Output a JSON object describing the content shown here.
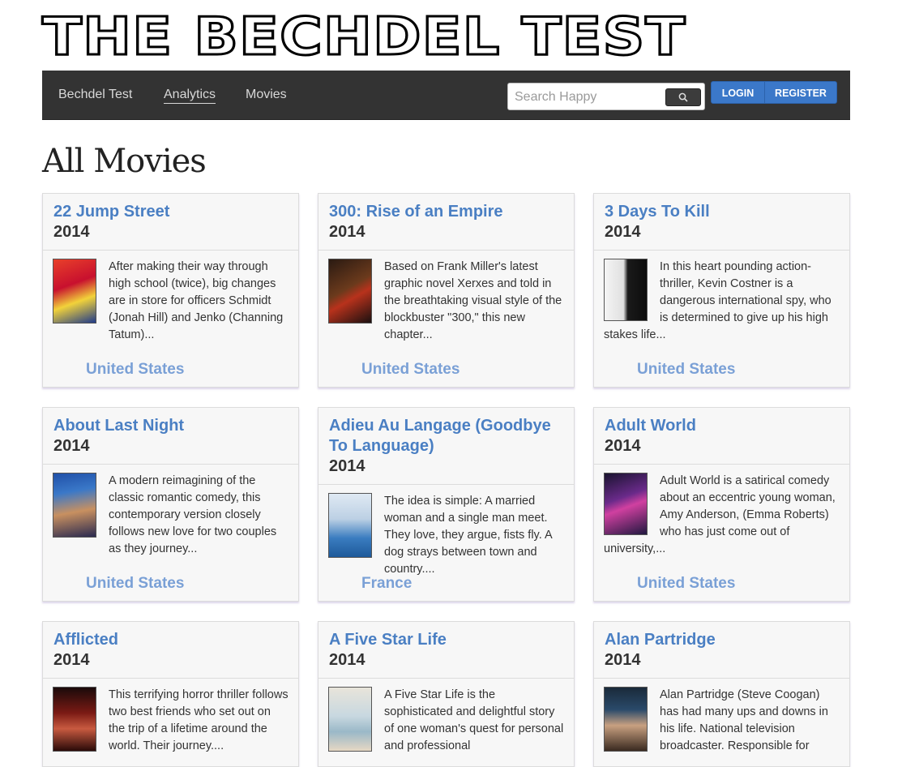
{
  "site": {
    "title": "THE BECHDEL TEST"
  },
  "nav": {
    "links": [
      "Bechdel Test",
      "Analytics",
      "Movies"
    ],
    "search_placeholder": "Search Happy",
    "login_label": "LOGIN",
    "register_label": "REGISTER"
  },
  "page": {
    "heading": "All Movies"
  },
  "colors": {
    "navbar": "#333333",
    "accent": "#3b78c9",
    "link": "#4a7fc3",
    "country": "#7aa0d6"
  },
  "movies": [
    {
      "title": "22 Jump Street",
      "year": "2014",
      "description": "After making their way through high school (twice), big changes are in store for officers Schmidt (Jonah Hill) and Jenko (Channing Tatum)...",
      "country": "United States"
    },
    {
      "title": "300: Rise of an Empire",
      "year": "2014",
      "description": "Based on Frank Miller's latest graphic novel Xerxes and told in the breathtaking visual style of the blockbuster \"300,\" this new chapter...",
      "country": "United States"
    },
    {
      "title": "3 Days To Kill",
      "year": "2014",
      "description": "In this heart pounding action-thriller, Kevin Costner is a dangerous international spy, who is determined to give up his high stakes life...",
      "country": "United States"
    },
    {
      "title": "About Last Night",
      "year": "2014",
      "description": "A modern reimagining of the classic romantic comedy, this contemporary version closely follows new love for two couples as they journey...",
      "country": "United States"
    },
    {
      "title": "Adieu Au Langage (Goodbye To Language)",
      "year": "2014",
      "description": "The idea is simple: A married woman and a single man meet. They love, they argue, fists fly. A dog strays between town and country....",
      "country": "France"
    },
    {
      "title": "Adult World",
      "year": "2014",
      "description": "Adult World is a satirical comedy about an eccentric young woman, Amy Anderson, (Emma Roberts) who has just come out of university,...",
      "country": "United States"
    },
    {
      "title": "Afflicted",
      "year": "2014",
      "description": "This terrifying horror thriller follows two best friends who set out on the trip of a lifetime around the world. Their journey....",
      "country": ""
    },
    {
      "title": "A Five Star Life",
      "year": "2014",
      "description": "A Five Star Life is the sophisticated and delightful story of one woman's quest for personal and professional",
      "country": ""
    },
    {
      "title": "Alan Partridge",
      "year": "2014",
      "description": "Alan Partridge (Steve Coogan) has had many ups and downs in his life. National television broadcaster. Responsible for",
      "country": ""
    }
  ]
}
